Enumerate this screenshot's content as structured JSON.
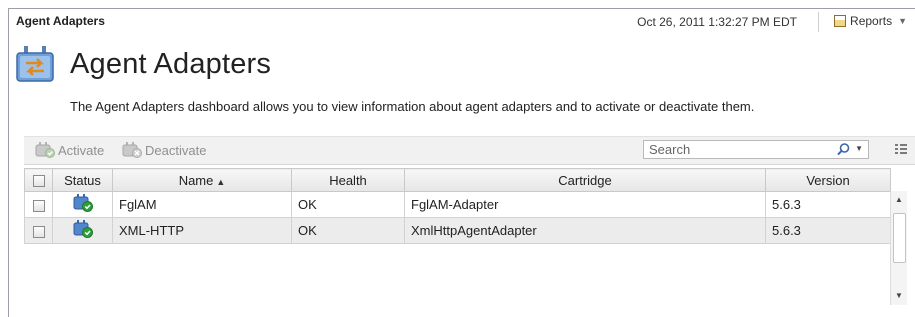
{
  "header": {
    "breadcrumb": "Agent Adapters",
    "timestamp": "Oct 26, 2011 1:32:27 PM EDT",
    "reports_label": "Reports"
  },
  "page": {
    "title": "Agent Adapters",
    "description": "The Agent Adapters dashboard allows you to view information about agent adapters and to activate or deactivate them.",
    "icon": "agent-adapter-icon"
  },
  "toolbar": {
    "activate_label": "Activate",
    "deactivate_label": "Deactivate",
    "search_placeholder": "Search"
  },
  "table": {
    "columns": {
      "status": "Status",
      "name": "Name",
      "health": "Health",
      "cartridge": "Cartridge",
      "version": "Version"
    },
    "sort": {
      "column": "Name",
      "direction": "ascending"
    },
    "rows": [
      {
        "name": "FglAM",
        "health": "OK",
        "cartridge": "FglAM-Adapter",
        "version": "5.6.3",
        "status_icon": "active-adapter-icon"
      },
      {
        "name": "XML-HTTP",
        "health": "OK",
        "cartridge": "XmlHttpAgentAdapter",
        "version": "5.6.3",
        "status_icon": "active-adapter-icon"
      }
    ]
  },
  "colors": {
    "ok_green": "#2e9e3c",
    "adapter_blue": "#3f7fc8",
    "row_alt": "#ececec"
  }
}
